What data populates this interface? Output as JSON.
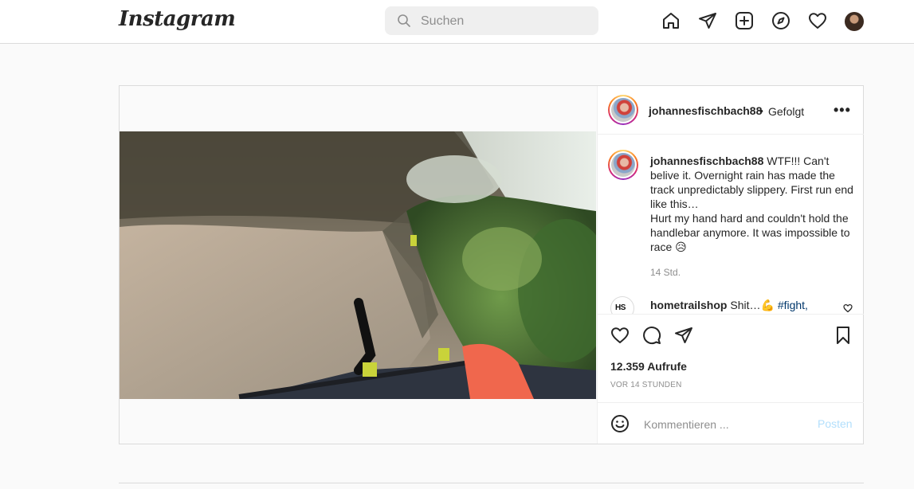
{
  "header": {
    "logo": "Instagram",
    "search_placeholder": "Suchen"
  },
  "nav_icons": [
    "home-icon",
    "direct-send-icon",
    "new-post-icon",
    "explore-compass-icon",
    "activity-heart-icon",
    "profile-avatar"
  ],
  "post": {
    "author": "johannesfischbach88",
    "separator": "•",
    "follow_status": "Gefolgt",
    "more": "•••",
    "caption": {
      "author": "johannesfischbach88",
      "text": "WTF!!! Can't belive it. Overnight rain has made the track unpredictably slippery. First run end like this…\nHurt my hand hard and couldn't hold the handlebar anymore. It was impossible to race 😥"
    },
    "caption_time": "14 Std.",
    "comments": [
      {
        "author": "hometrailshop",
        "avatar_text": "HS",
        "text": "Shit…💪 ",
        "hashtag": "#fight,"
      }
    ],
    "views": "12.359 Aufrufe",
    "posted_ago": "VOR 14 STUNDEN",
    "comment_placeholder": "Kommentieren ...",
    "post_button": "Posten"
  },
  "colors": {
    "link": "#00376b",
    "post_button_disabled": "#b2dffc",
    "muted": "#8e8e8e",
    "border": "#dbdbdb"
  }
}
